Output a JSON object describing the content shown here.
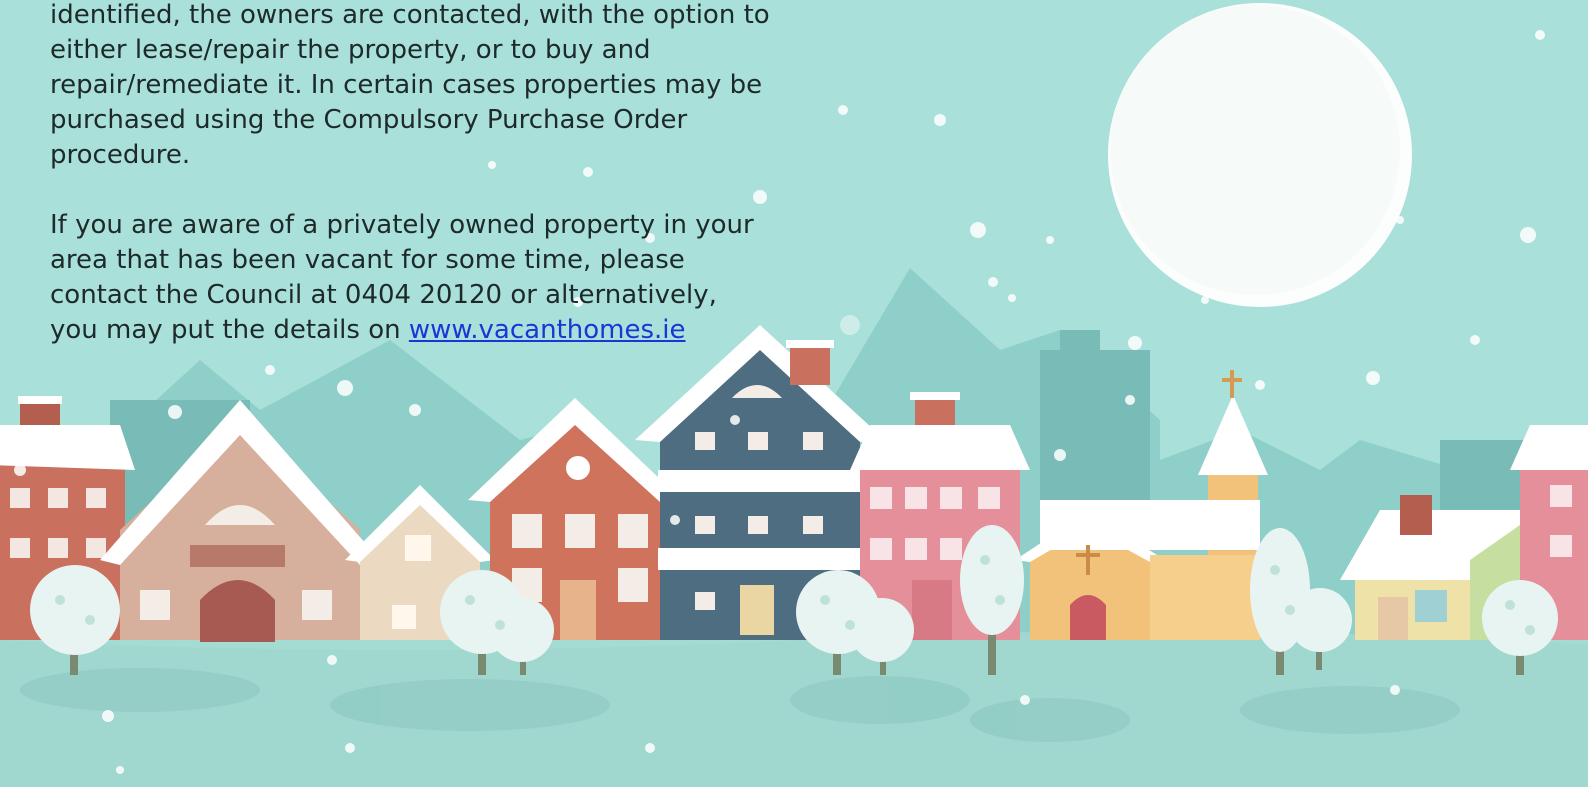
{
  "article": {
    "paragraph1": "identified, the owners are contacted, with the option to either lease/repair the property, or to buy and repair/remediate it. In certain cases properties may be purchased using the Compulsory Purchase Order procedure.",
    "paragraph2_text": "If you are aware of a privately owned property in your area that has been vacant for some time, please contact the Council at 0404 20120 or alternatively, you may put the details on ",
    "link_text": "www.vacanthomes.ie"
  },
  "colors": {
    "sky": "#a9e0d9",
    "text": "#1e2a2a",
    "link": "#1a36d6",
    "snow": "#ffffff",
    "mountain": "#86c9c4",
    "house_red": "#c9705e",
    "house_blue": "#4f6d80",
    "house_pink": "#e58f9a",
    "house_yellow": "#f3c27a",
    "house_beige": "#d9b3a0"
  }
}
